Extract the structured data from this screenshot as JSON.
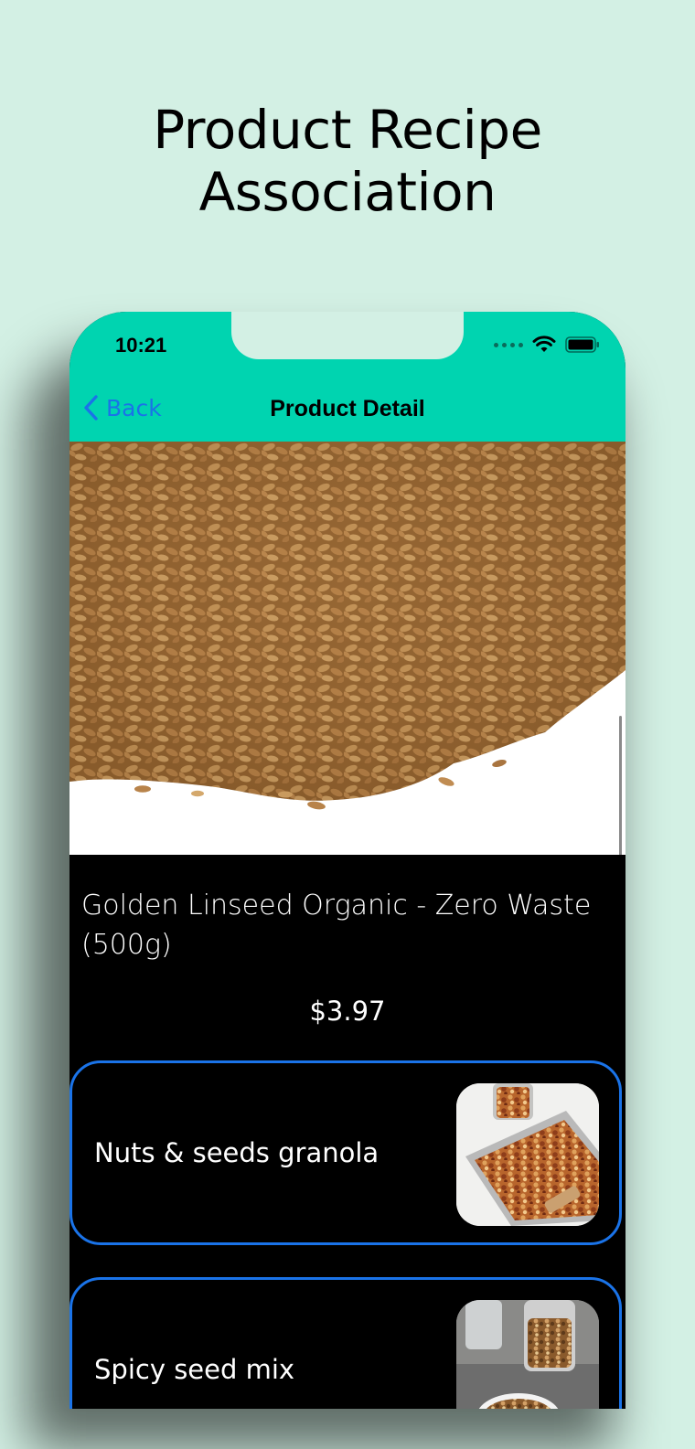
{
  "headline": {
    "line1": "Product Recipe",
    "line2": "Association"
  },
  "status_bar": {
    "time": "10:21"
  },
  "nav": {
    "back_label": "Back",
    "title": "Product Detail"
  },
  "product": {
    "name": "Golden Linseed Organic - Zero Waste (500g)",
    "price": "$3.97"
  },
  "recipes": [
    {
      "name": "Nuts & seeds granola"
    },
    {
      "name": "Spicy seed mix"
    }
  ],
  "colors": {
    "background": "#d3f0e4",
    "nav_bar": "#00d4b0",
    "accent_blue": "#1a73e8",
    "content_bg": "#000000"
  },
  "icons": [
    "back-chevron-icon",
    "signal-dots-icon",
    "wifi-icon",
    "battery-icon"
  ]
}
